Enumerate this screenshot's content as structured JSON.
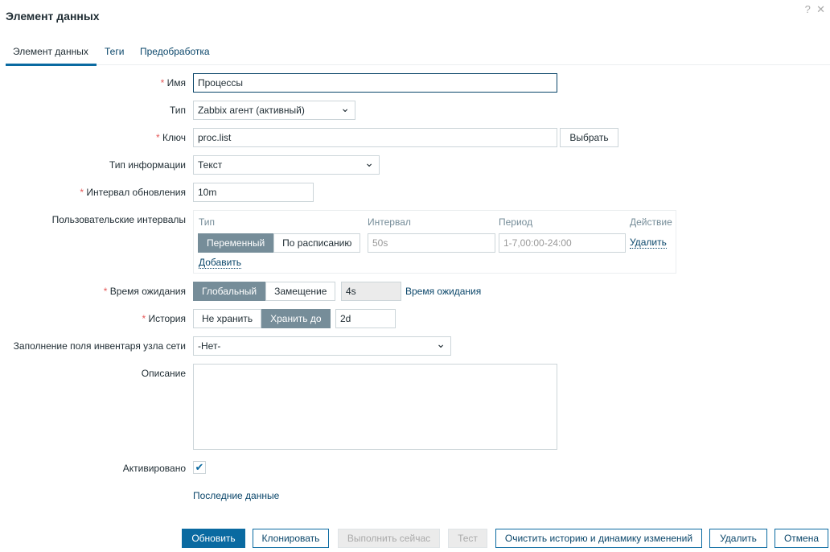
{
  "dialog": {
    "title": "Элемент данных",
    "help_icon": "?",
    "close_icon": "✕"
  },
  "tabs": [
    {
      "label": "Элемент данных"
    },
    {
      "label": "Теги"
    },
    {
      "label": "Предобработка"
    }
  ],
  "form": {
    "name": {
      "label": "Имя",
      "value": "Процессы"
    },
    "type": {
      "label": "Тип",
      "value": "Zabbix агент (активный)"
    },
    "key": {
      "label": "Ключ",
      "value": "proc.list",
      "select_button": "Выбрать"
    },
    "info_type": {
      "label": "Тип информации",
      "value": "Текст"
    },
    "update_interval": {
      "label": "Интервал обновления",
      "value": "10m"
    },
    "custom_intervals": {
      "label": "Пользовательские интервалы",
      "headers": [
        "Тип",
        "Интервал",
        "Период",
        "Действие"
      ],
      "type_options": [
        "Переменный",
        "По расписанию"
      ],
      "interval_placeholder": "50s",
      "period_placeholder": "1-7,00:00-24:00",
      "remove": "Удалить",
      "add": "Добавить"
    },
    "timeout": {
      "label": "Время ожидания",
      "options": [
        "Глобальный",
        "Замещение"
      ],
      "value": "4s",
      "link": "Время ожидания"
    },
    "history": {
      "label": "История",
      "options": [
        "Не хранить",
        "Хранить до"
      ],
      "value": "2d"
    },
    "inventory": {
      "label": "Заполнение поля инвентаря узла сети",
      "value": "-Нет-"
    },
    "description": {
      "label": "Описание",
      "value": ""
    },
    "enabled": {
      "label": "Активировано",
      "checked": true
    },
    "latest_data": "Последние данные"
  },
  "buttons": {
    "update": "Обновить",
    "clone": "Клонировать",
    "execute": "Выполнить сейчас",
    "test": "Тест",
    "clear": "Очистить историю и динамику изменений",
    "delete": "Удалить",
    "cancel": "Отмена"
  }
}
